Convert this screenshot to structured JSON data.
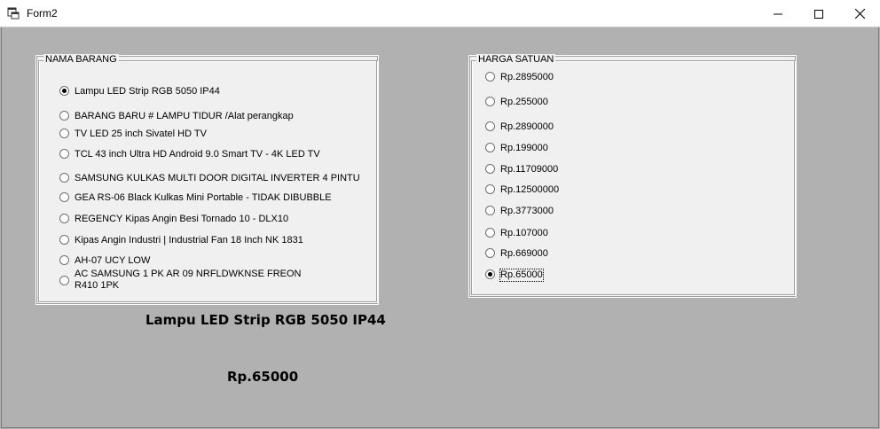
{
  "window": {
    "title": "Form2"
  },
  "nama_barang": {
    "legend": "NAMA BARANG",
    "items": [
      {
        "label": "Lampu LED Strip RGB 5050 IP44",
        "checked": true
      },
      {
        "label": "BARANG BARU # LAMPU TIDUR /Alat perangkap",
        "checked": false
      },
      {
        "label": "TV LED 25 inch Sivatel HD TV",
        "checked": false
      },
      {
        "label": "TCL 43 inch Ultra HD Android 9.0 Smart TV - 4K LED TV",
        "checked": false
      },
      {
        "label": "SAMSUNG KULKAS MULTI DOOR DIGITAL INVERTER 4 PINTU",
        "checked": false
      },
      {
        "label": "GEA RS-06 Black Kulkas Mini Portable - TIDAK DIBUBBLE",
        "checked": false
      },
      {
        "label": "REGENCY Kipas Angin Besi Tornado 10 - DLX10",
        "checked": false
      },
      {
        "label": "Kipas Angin Industri | Industrial Fan 18 Inch NK 1831",
        "checked": false
      },
      {
        "label": "AH-07 UCY LOW",
        "checked": false
      },
      {
        "label": "AC SAMSUNG 1 PK AR 09 NRFLDWKNSE FREON\nR410 1PK",
        "checked": false
      }
    ]
  },
  "harga_satuan": {
    "legend": "HARGA SATUAN",
    "items": [
      {
        "label": "Rp.2895000",
        "checked": false
      },
      {
        "label": "Rp.255000",
        "checked": false
      },
      {
        "label": "Rp.2890000",
        "checked": false
      },
      {
        "label": "Rp.199000",
        "checked": false
      },
      {
        "label": "Rp.11709000",
        "checked": false
      },
      {
        "label": "Rp.12500000",
        "checked": false
      },
      {
        "label": "Rp.3773000",
        "checked": false
      },
      {
        "label": "Rp.107000",
        "checked": false
      },
      {
        "label": "Rp.669000",
        "checked": false
      },
      {
        "label": "Rp.65000",
        "checked": true
      }
    ]
  },
  "result": {
    "selected_item": "Lampu LED Strip RGB 5050 IP44",
    "selected_price": "Rp.65000"
  }
}
